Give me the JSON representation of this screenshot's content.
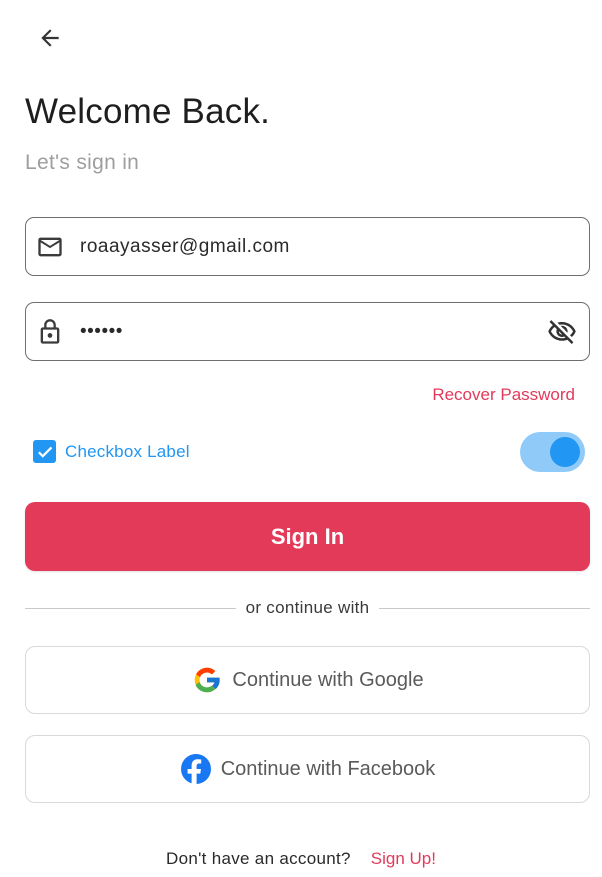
{
  "header": {
    "back_icon": "arrow-left-icon"
  },
  "title": "Welcome Back.",
  "subtitle": "Let's sign in",
  "email_field": {
    "icon": "mail-icon",
    "value": "roaayasser@gmail.com"
  },
  "password_field": {
    "icon": "lock-icon",
    "value": "••••••",
    "toggle_icon": "eye-off-icon"
  },
  "recover_password": "Recover Password",
  "checkbox": {
    "label": "Checkbox Label",
    "checked": true
  },
  "switch": {
    "on": true
  },
  "sign_in_button": "Sign In",
  "divider_text": "or continue with",
  "google_button": {
    "icon": "google-icon",
    "label": "Continue with Google"
  },
  "facebook_button": {
    "icon": "facebook-icon",
    "label": "Continue with Facebook"
  },
  "footer": {
    "question": "Don't have an account?",
    "signup_link": "Sign Up!"
  },
  "colors": {
    "accent": "#e43a5a",
    "blue": "#2196f3",
    "switch_track": "#90caf9"
  }
}
